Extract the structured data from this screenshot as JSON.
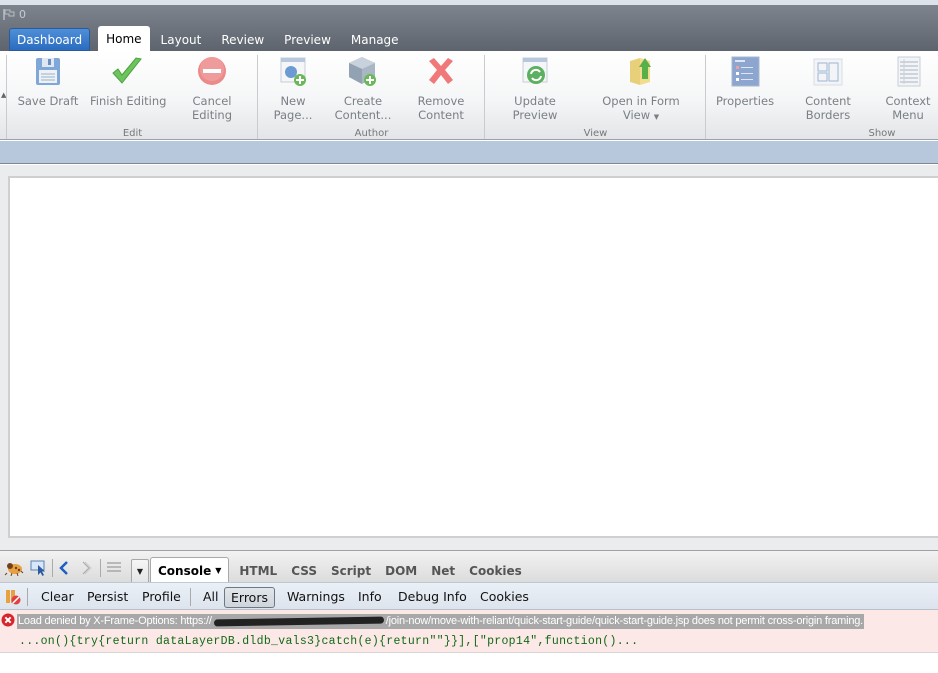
{
  "header": {
    "notification_count": "0",
    "tabs": [
      {
        "label": "Dashboard",
        "state": "dashboard"
      },
      {
        "label": "Home",
        "state": "active"
      },
      {
        "label": "Layout",
        "state": "plain"
      },
      {
        "label": "Review",
        "state": "plain"
      },
      {
        "label": "Preview",
        "state": "plain"
      },
      {
        "label": "Manage",
        "state": "plain"
      }
    ]
  },
  "ribbon": {
    "groups": [
      {
        "label": "Edit",
        "buttons": [
          {
            "label": "Save Draft",
            "icon": "floppy-disk-icon"
          },
          {
            "label": "Finish Editing",
            "icon": "checkmark-icon"
          },
          {
            "label_line1": "Cancel",
            "label_line2": "Editing",
            "icon": "cancel-icon"
          }
        ]
      },
      {
        "label": "Author",
        "buttons": [
          {
            "label_line1": "New",
            "label_line2": "Page...",
            "icon": "new-page-icon"
          },
          {
            "label_line1": "Create",
            "label_line2": "Content...",
            "icon": "create-content-icon"
          },
          {
            "label_line1": "Remove",
            "label_line2": "Content",
            "icon": "remove-x-icon"
          }
        ]
      },
      {
        "label": "View",
        "buttons": [
          {
            "label_line1": "Update",
            "label_line2": "Preview",
            "icon": "refresh-icon"
          },
          {
            "label_line1": "Open in Form",
            "label_line2": "View",
            "icon": "folder-icon",
            "dropdown": true
          }
        ]
      },
      {
        "label": "Show",
        "buttons": [
          {
            "label": "Properties",
            "icon": "properties-icon"
          },
          {
            "label_line1": "Content",
            "label_line2": "Borders",
            "icon": "content-borders-icon"
          },
          {
            "label_line1": "Context",
            "label_line2": "Menu",
            "icon": "context-menu-icon"
          }
        ]
      }
    ]
  },
  "firebug": {
    "panel_tabs": [
      "Console",
      "HTML",
      "CSS",
      "Script",
      "DOM",
      "Net",
      "Cookies"
    ],
    "active_panel": "Console",
    "console_toolbar": {
      "clear": "Clear",
      "persist": "Persist",
      "profile": "Profile",
      "filters": [
        "All",
        "Errors",
        "Warnings",
        "Info",
        "Debug Info",
        "Cookies"
      ],
      "selected_filter": "Errors"
    },
    "log": {
      "message_prefix": "Load denied by X-Frame-Options: https://",
      "message_suffix": "/join-now/move-with-reliant/quick-start-guide/quick-start-guide.jsp does not permit cross-origin framing.",
      "code": "...on(){try{return dataLayerDB.dldb_vals3}catch(e){return\"\"}}],[\"prop14\",function()..."
    }
  }
}
